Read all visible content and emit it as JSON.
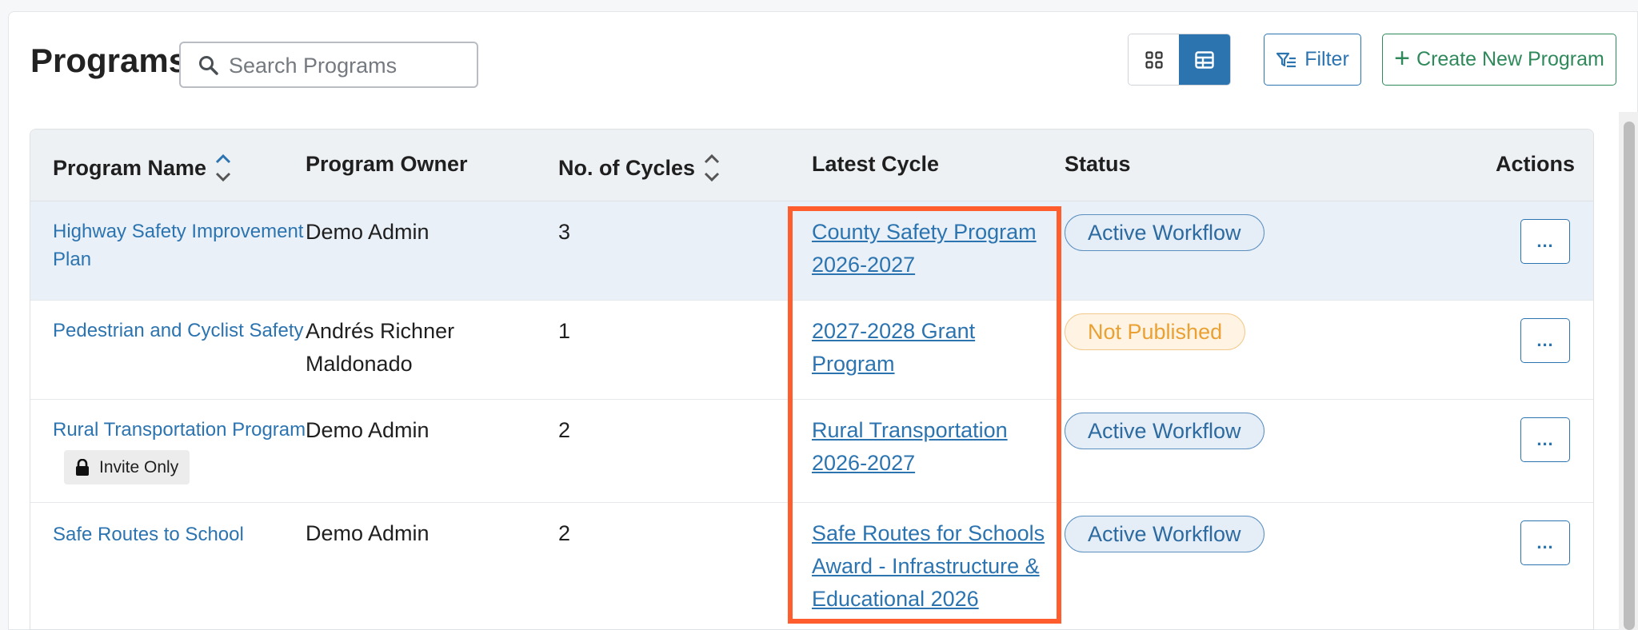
{
  "page": {
    "title": "Programs"
  },
  "search": {
    "placeholder": "Search Programs"
  },
  "toolbar": {
    "grid_view_icon": "grid-icon",
    "table_view_icon": "table-icon",
    "filter_label": "Filter",
    "create_label": "Create New Program",
    "accent_blue": "#2c74b0",
    "accent_green": "#2f8a5b"
  },
  "table": {
    "headers": {
      "program_name": "Program Name",
      "program_owner": "Program Owner",
      "cycles": "No. of Cycles",
      "latest_cycle": "Latest Cycle",
      "status": "Status",
      "actions": "Actions"
    },
    "rows": [
      {
        "name_line1": "Highway Safety Improvement",
        "name_line2": "Plan",
        "owner_line1": "Demo Admin",
        "owner_line2": "",
        "cycles": "3",
        "latest_line1": "County Safety Program",
        "latest_line2": "2026-2027",
        "latest_line3": "",
        "status": "Active Workflow",
        "action": "...",
        "tag": ""
      },
      {
        "name_line1": "Pedestrian and Cyclist Safety",
        "name_line2": "",
        "owner_line1": "Andrés Richner",
        "owner_line2": "Maldonado",
        "cycles": "1",
        "latest_line1": "2027-2028 Grant",
        "latest_line2": "Program",
        "latest_line3": "",
        "status": "Not Published",
        "action": "...",
        "tag": ""
      },
      {
        "name_line1": "Rural Transportation Program",
        "name_line2": "",
        "owner_line1": "Demo Admin",
        "owner_line2": "",
        "cycles": "2",
        "latest_line1": "Rural Transportation",
        "latest_line2": "2026-2027",
        "latest_line3": "",
        "status": "Active Workflow",
        "action": "...",
        "tag": "Invite Only"
      },
      {
        "name_line1": "Safe Routes to School",
        "name_line2": "",
        "owner_line1": "Demo Admin",
        "owner_line2": "",
        "cycles": "2",
        "latest_line1": "Safe Routes for Schools",
        "latest_line2": "Award - Infrastructure &",
        "latest_line3": "Educational 2026",
        "status": "Active Workflow",
        "action": "...",
        "tag": ""
      }
    ]
  },
  "colors": {
    "highlight_outline": "#ff5d2e",
    "active_badge": "#2c6aa0",
    "not_published_badge": "#eaa032"
  }
}
